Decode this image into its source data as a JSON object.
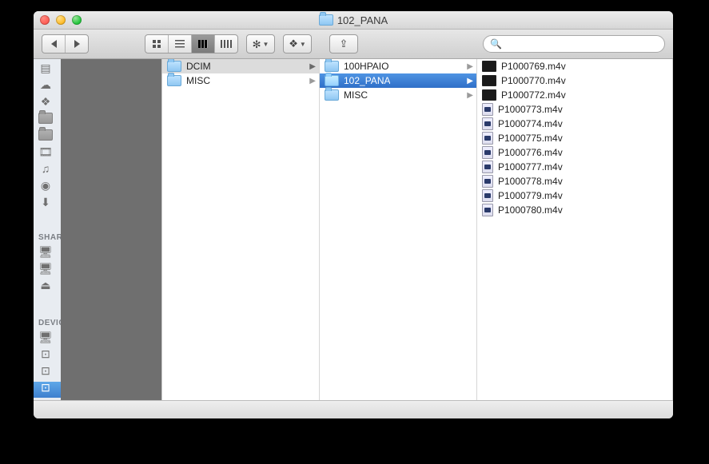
{
  "window": {
    "title": "102_PANA"
  },
  "toolbar": {
    "search_placeholder": ""
  },
  "sidebar": {
    "sections": {
      "shared_label": "SHARED",
      "devices_label": "DEVICES"
    }
  },
  "columns": {
    "col1": [
      {
        "name": "DCIM",
        "type": "folder",
        "selected": "grey"
      },
      {
        "name": "MISC",
        "type": "folder"
      }
    ],
    "col2": [
      {
        "name": "100HPAIO",
        "type": "folder"
      },
      {
        "name": "102_PANA",
        "type": "folder",
        "selected": "blue"
      },
      {
        "name": "MISC",
        "type": "folder"
      }
    ],
    "col3": [
      {
        "name": "P1000769.m4v",
        "type": "video-dark"
      },
      {
        "name": "P1000770.m4v",
        "type": "video-dark"
      },
      {
        "name": "P1000772.m4v",
        "type": "video-dark"
      },
      {
        "name": "P1000773.m4v",
        "type": "video-doc"
      },
      {
        "name": "P1000774.m4v",
        "type": "video-doc"
      },
      {
        "name": "P1000775.m4v",
        "type": "video-doc"
      },
      {
        "name": "P1000776.m4v",
        "type": "video-doc"
      },
      {
        "name": "P1000777.m4v",
        "type": "video-doc"
      },
      {
        "name": "P1000778.m4v",
        "type": "video-doc"
      },
      {
        "name": "P1000779.m4v",
        "type": "video-doc"
      },
      {
        "name": "P1000780.m4v",
        "type": "video-doc"
      }
    ]
  }
}
